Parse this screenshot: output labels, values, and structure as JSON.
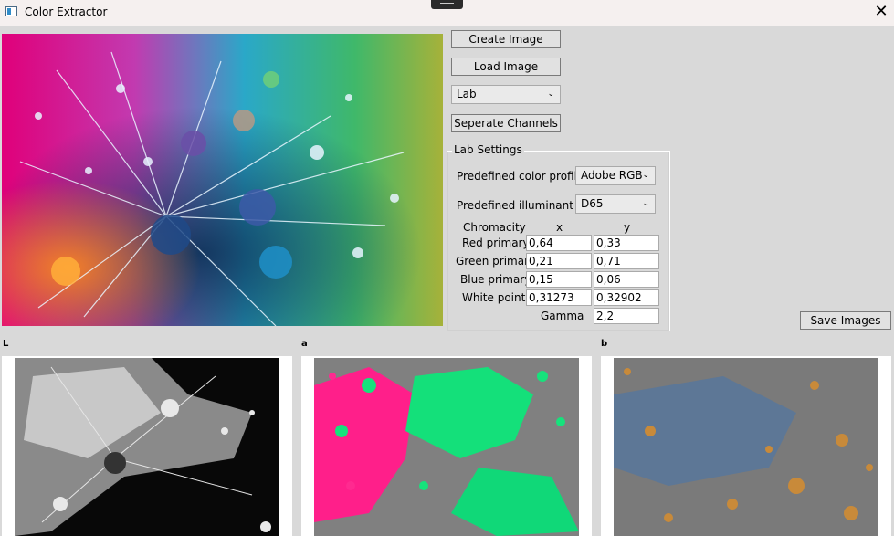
{
  "window": {
    "title": "Color Extractor",
    "close_glyph": "✕"
  },
  "toolbar": {
    "create_label": "Create Image",
    "load_label": "Load Image",
    "color_space": "Lab",
    "separate_label": "Seperate Channels",
    "save_label": "Save Images"
  },
  "lab_settings": {
    "title": "Lab Settings",
    "profile_label": "Predefined color profile",
    "profile_value": "Adobe RGB",
    "illuminant_label": "Predefined illuminant",
    "illuminant_value": "D65",
    "chromacity_label": "Chromacity",
    "x_header": "x",
    "y_header": "y",
    "rows": [
      {
        "label": "Red primary",
        "x": "0,64",
        "y": "0,33"
      },
      {
        "label": "Green primary",
        "x": "0,21",
        "y": "0,71"
      },
      {
        "label": "Blue primary",
        "x": "0,15",
        "y": "0,06"
      },
      {
        "label": "White point",
        "x": "0,31273",
        "y": "0,32902"
      }
    ],
    "gamma_label": "Gamma",
    "gamma_value": "2,2"
  },
  "channels": [
    {
      "label": "L"
    },
    {
      "label": "a"
    },
    {
      "label": "b"
    }
  ],
  "colors": {
    "window_bg": "#d9d9d9",
    "titlebar_bg": "#f5f0ef",
    "button_bg": "#e1e1e1"
  }
}
